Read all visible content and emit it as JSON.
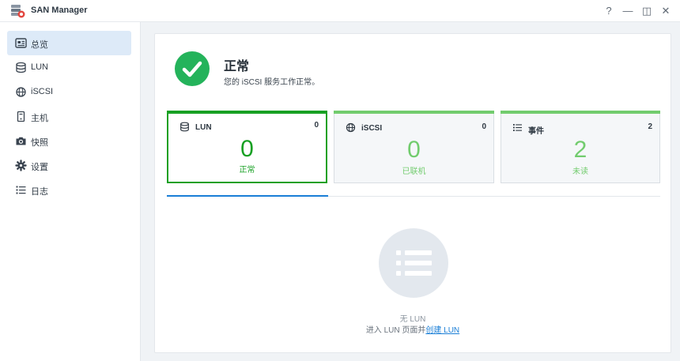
{
  "window": {
    "title": "SAN Manager",
    "buttons": {
      "help": "?",
      "minimize": "—",
      "maximize": "◫",
      "close": "✕"
    }
  },
  "sidebar": {
    "items": [
      {
        "label": "总览",
        "icon": "overview-icon",
        "active": true
      },
      {
        "label": "LUN",
        "icon": "database-icon"
      },
      {
        "label": "iSCSI",
        "icon": "globe-icon"
      },
      {
        "label": "主机",
        "icon": "host-icon"
      },
      {
        "label": "快照",
        "icon": "camera-icon"
      },
      {
        "label": "设置",
        "icon": "gear-icon"
      },
      {
        "label": "日志",
        "icon": "list-icon"
      }
    ]
  },
  "status": {
    "title": "正常",
    "description": "您的 iSCSI 服务工作正常。",
    "color": "#24b35b"
  },
  "cards": [
    {
      "label": "LUN",
      "count": "0",
      "value": "0",
      "subtitle": "正常",
      "icon": "database-icon",
      "active": true,
      "color": "#17a023"
    },
    {
      "label": "iSCSI",
      "count": "0",
      "value": "0",
      "subtitle": "已联机",
      "icon": "globe-icon",
      "color": "#72cc6e"
    },
    {
      "label": "事件",
      "count": "2",
      "value": "2",
      "subtitle": "未读",
      "icon": "list-icon",
      "color": "#72cc6e"
    }
  ],
  "empty_state": {
    "icon": "list-icon",
    "title": "无 LUN",
    "prefix": "进入 LUN 页面并",
    "link": "创建 LUN"
  },
  "colors": {
    "accent": "#1a7ed6",
    "success": "#17a023",
    "success_light": "#72cc6e"
  }
}
